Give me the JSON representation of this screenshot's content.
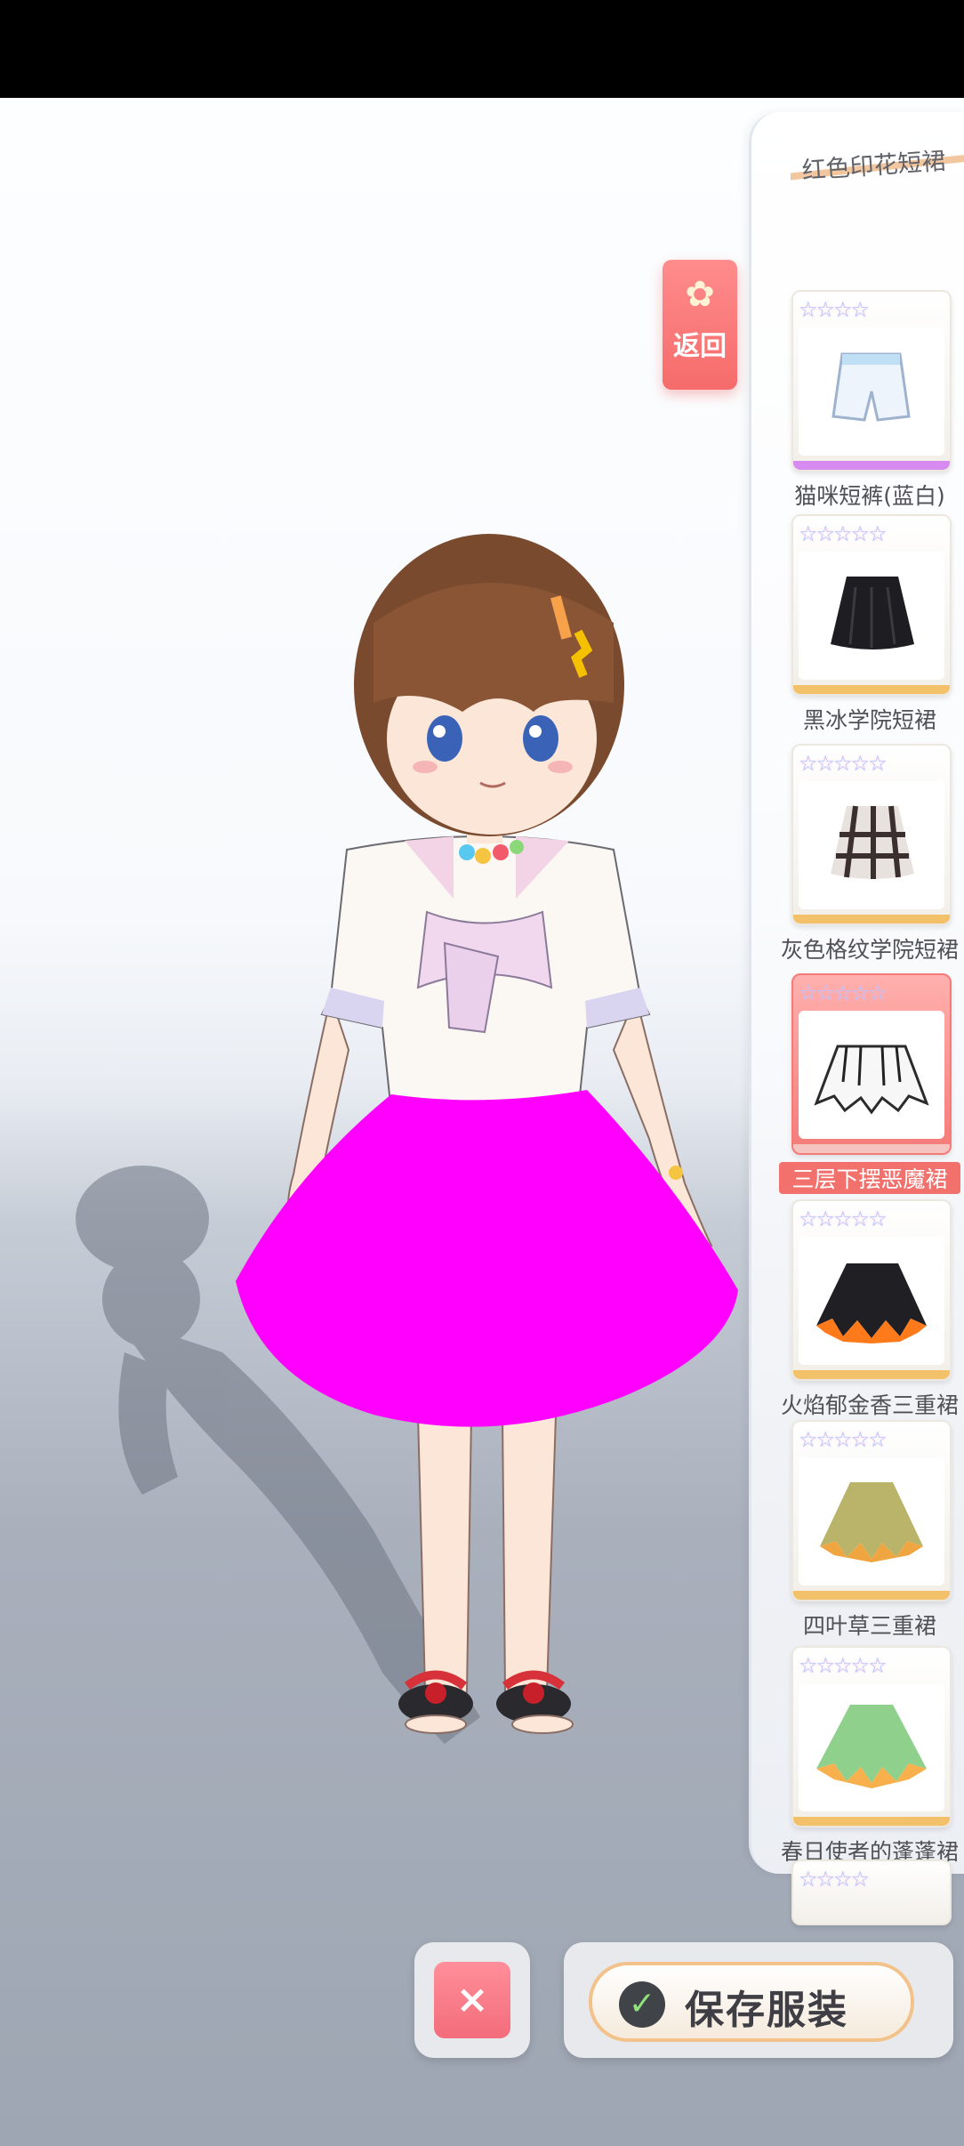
{
  "back_button": {
    "label": "返回"
  },
  "panel": {
    "top_item_name": "红色印花短裙",
    "items": [
      {
        "name": "猫咪短裤(蓝白)",
        "stars": "☆☆☆☆",
        "icon": "shorts-icon"
      },
      {
        "name": "黑冰学院短裙",
        "stars": "☆☆☆☆☆",
        "icon": "black-skirt-icon"
      },
      {
        "name": "灰色格纹学院短裙",
        "stars": "☆☆☆☆☆",
        "icon": "plaid-skirt-icon"
      },
      {
        "name": "三层下摆恶魔裙",
        "stars": "☆☆☆☆☆",
        "icon": "devil-skirt-icon",
        "selected": true
      },
      {
        "name": "火焰郁金香三重裙",
        "stars": "☆☆☆☆☆",
        "icon": "flame-skirt-icon"
      },
      {
        "name": "四叶草三重裙",
        "stars": "☆☆☆☆☆",
        "icon": "clover-skirt-icon"
      },
      {
        "name": "春日使者的蓬蓬裙",
        "stars": "☆☆☆☆☆",
        "icon": "spring-skirt-icon"
      },
      {
        "name": "",
        "stars": "☆☆☆☆",
        "icon": "next-item-icon"
      }
    ]
  },
  "actions": {
    "cancel_symbol": "×",
    "save_label": "保存服装"
  },
  "colors": {
    "accent": "#f47b78",
    "skirt_preview": "#ff00ff",
    "gold": "#f2c16a"
  }
}
